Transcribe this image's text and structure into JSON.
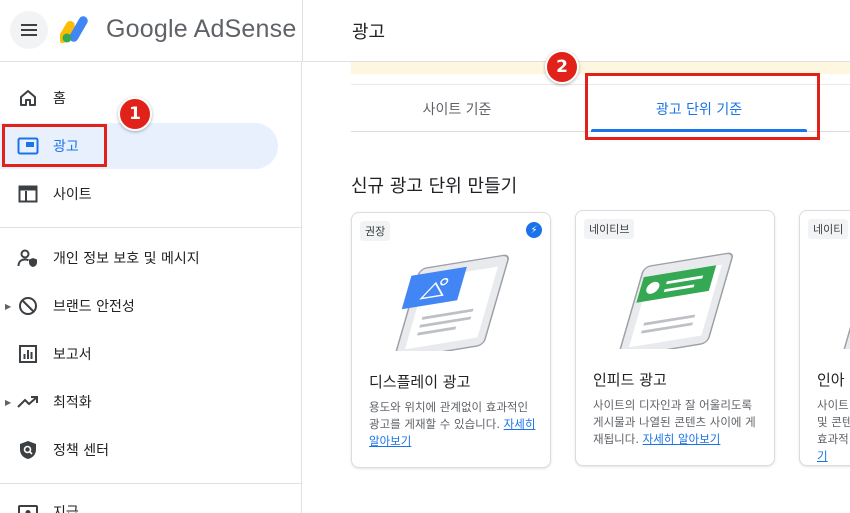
{
  "header": {
    "logo_text": "Google AdSense",
    "page_title": "광고"
  },
  "sidebar": {
    "items": [
      {
        "label": "홈"
      },
      {
        "label": "광고"
      },
      {
        "label": "사이트"
      },
      {
        "label": "개인 정보 보호 및 메시지"
      },
      {
        "label": "브랜드 안전성"
      },
      {
        "label": "보고서"
      },
      {
        "label": "최적화"
      },
      {
        "label": "정책 센터"
      },
      {
        "label": "지급"
      }
    ]
  },
  "annotations": {
    "badge1": "1",
    "badge2": "2"
  },
  "tabs": [
    {
      "label": "사이트 기준"
    },
    {
      "label": "광고 단위 기준"
    }
  ],
  "section_title": "신규 광고 단위 만들기",
  "cards": [
    {
      "chip": "권장",
      "title": "디스플레이 광고",
      "desc": "용도와 위치에 관계없이 효과적인 광고를 게재할 수 있습니다.",
      "link": "자세히 알아보기"
    },
    {
      "chip": "네이티브",
      "title": "인피드 광고",
      "desc": "사이트의 디자인과 잘 어울리도록 게시물과 나열된 콘텐츠 사이에 게재됩니다.",
      "link": "자세히 알아보기"
    },
    {
      "chip": "네이티",
      "title": "인아",
      "desc": "사이트 및 콘텐 효과적",
      "link": "기"
    }
  ],
  "colors": {
    "accent": "#1a73e8",
    "annotation_red": "#e0221b",
    "active_nav_bg": "#e8f0fe"
  }
}
